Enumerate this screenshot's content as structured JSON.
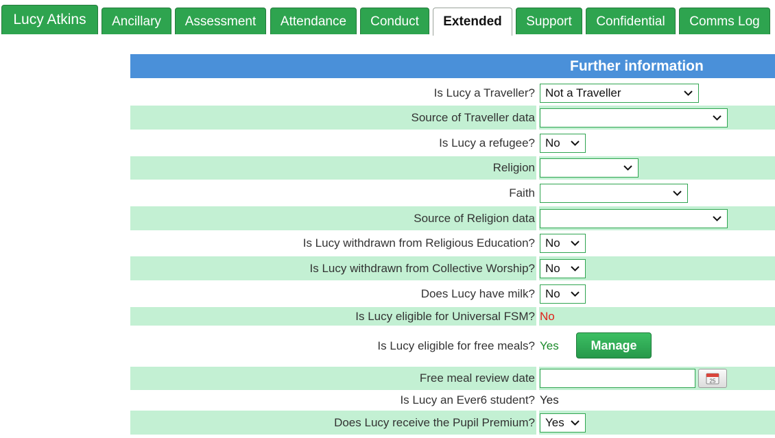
{
  "tabs": {
    "student": "Lucy Atkins",
    "items": [
      "Ancillary",
      "Assessment",
      "Attendance",
      "Conduct",
      "Extended",
      "Support",
      "Confidential",
      "Comms Log"
    ],
    "active": "Extended"
  },
  "section": {
    "title": "Further information"
  },
  "rows": {
    "traveller": {
      "label": "Is Lucy a Traveller?",
      "value": "Not a Traveller"
    },
    "traveller_source": {
      "label": "Source of Traveller data",
      "value": ""
    },
    "refugee": {
      "label": "Is Lucy a refugee?",
      "value": "No"
    },
    "religion": {
      "label": "Religion",
      "value": ""
    },
    "faith": {
      "label": "Faith",
      "value": ""
    },
    "religion_source": {
      "label": "Source of Religion data",
      "value": ""
    },
    "withdrawn_re": {
      "label": "Is Lucy withdrawn from Religious Education?",
      "value": "No"
    },
    "withdrawn_worship": {
      "label": "Is Lucy withdrawn from Collective Worship?",
      "value": "No"
    },
    "milk": {
      "label": "Does Lucy have milk?",
      "value": "No"
    },
    "universal_fsm": {
      "label": "Is Lucy eligible for Universal FSM?",
      "value": "No"
    },
    "free_meals": {
      "label": "Is Lucy eligible for free meals?",
      "value": "Yes",
      "button": "Manage"
    },
    "review_date": {
      "label": "Free meal review date",
      "value": "",
      "calendar_icon_text": "25"
    },
    "ever6": {
      "label": "Is Lucy an Ever6 student?",
      "value": "Yes"
    },
    "pupil_premium": {
      "label": "Does Lucy receive the Pupil Premium?",
      "value": "Yes"
    }
  },
  "colors": {
    "tab_green": "#2ea44f",
    "header_blue": "#4a90d9",
    "row_alt": "#c3f0d3",
    "value_no": "#e0201a",
    "value_yes": "#1b8a2a"
  }
}
